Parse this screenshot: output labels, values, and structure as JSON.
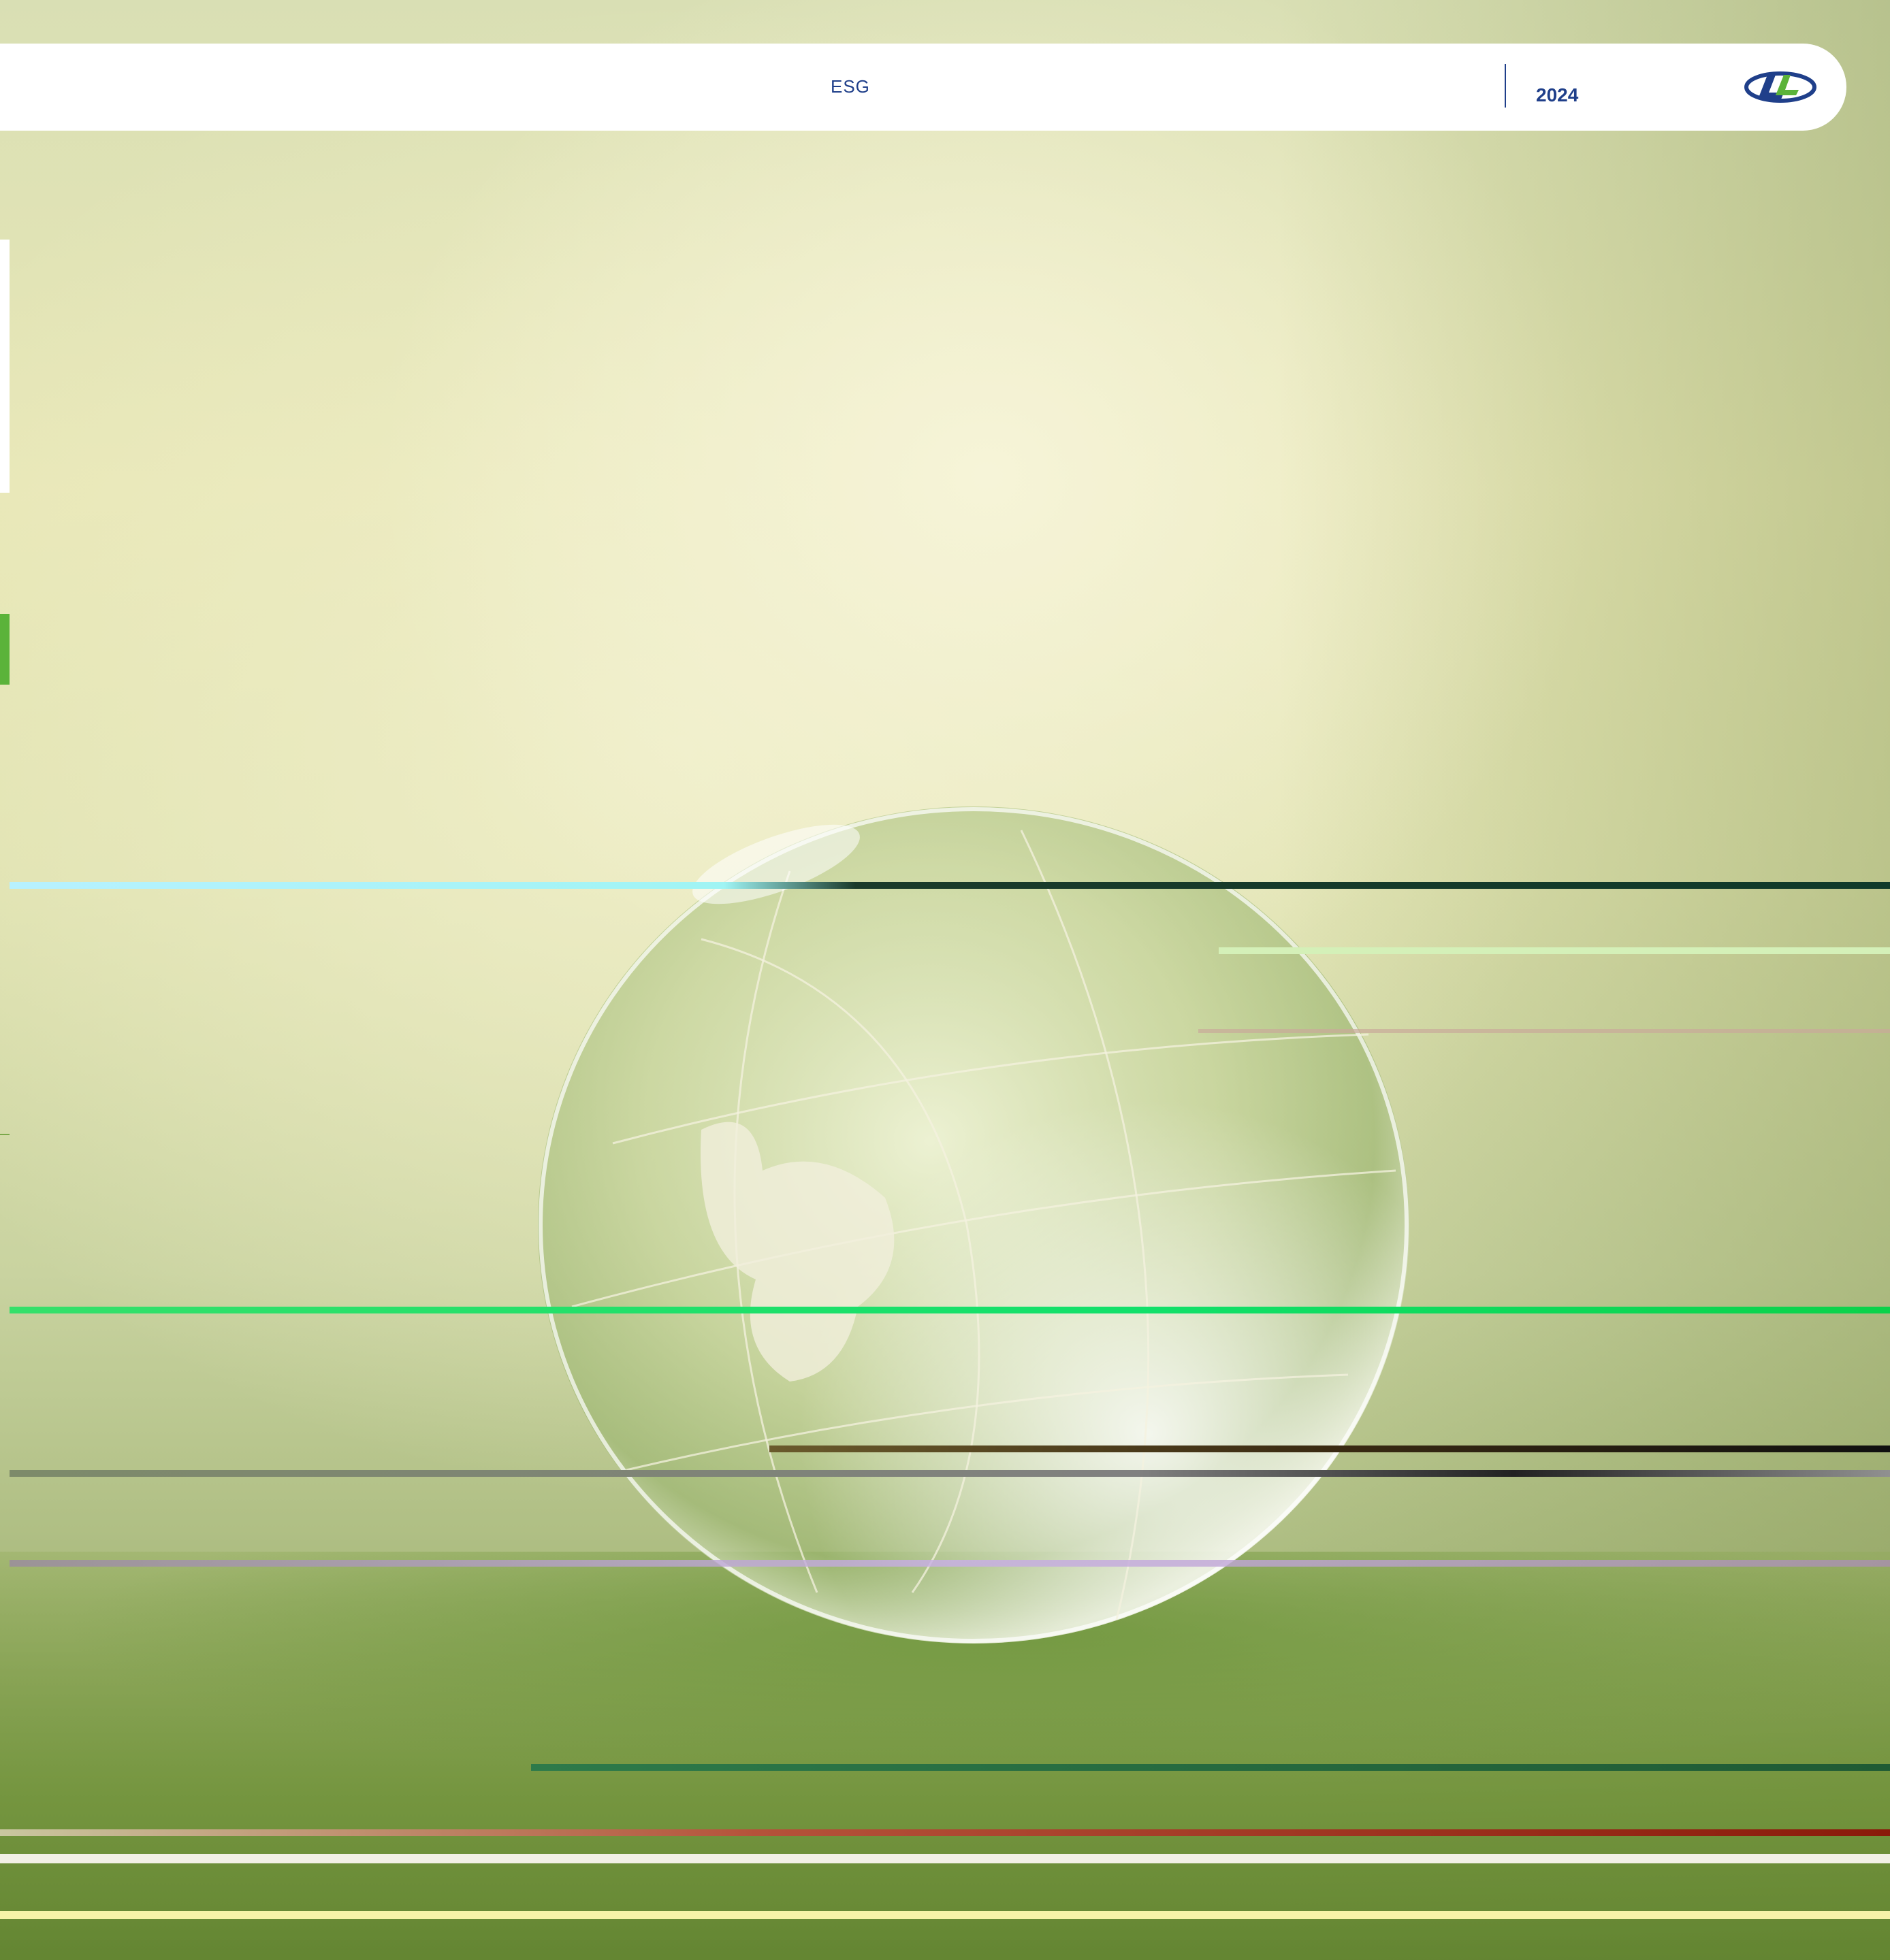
{
  "header": {
    "title": "ESG",
    "year": "2024",
    "logo_icon": "ll-logo-icon"
  },
  "colors": {
    "brand_blue": "#1f3f8a",
    "brand_green": "#5bb33a",
    "background_green": "#c9d3a0"
  },
  "background": {
    "image": "glass-globe-on-grass"
  }
}
